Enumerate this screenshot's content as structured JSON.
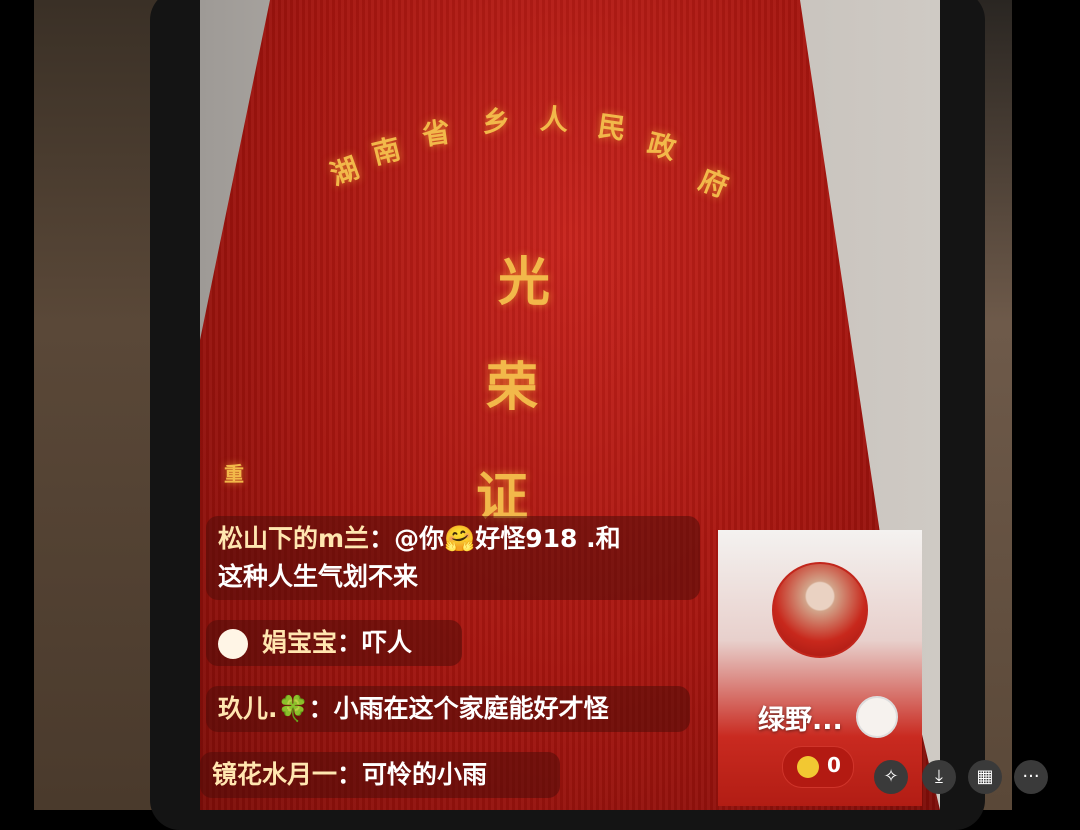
{
  "book": {
    "arc_text": [
      "湖",
      "南",
      "省",
      "乡",
      "人",
      "民",
      "政",
      "府"
    ],
    "title_chars": [
      "光",
      "荣",
      "证"
    ],
    "partial_char": "重"
  },
  "chat": [
    {
      "user": "松山下的m兰",
      "text": "：@你🤗好怪918 .和",
      "text2": "这种人生气划不来"
    },
    {
      "user": "娟宝宝",
      "text": "：吓人"
    },
    {
      "user": "玖儿.🍀",
      "text": "：小雨在这个家庭能好才怪"
    },
    {
      "user": "镜花水月一",
      "text": "：可怜的小雨"
    }
  ],
  "card": {
    "name": "绿野...",
    "follow_icon": "plus-icon",
    "count": "0"
  },
  "toolbar": {
    "icons": [
      "sparkle-icon",
      "download-icon",
      "grid-icon",
      "more-icon"
    ],
    "more_label": "···"
  }
}
